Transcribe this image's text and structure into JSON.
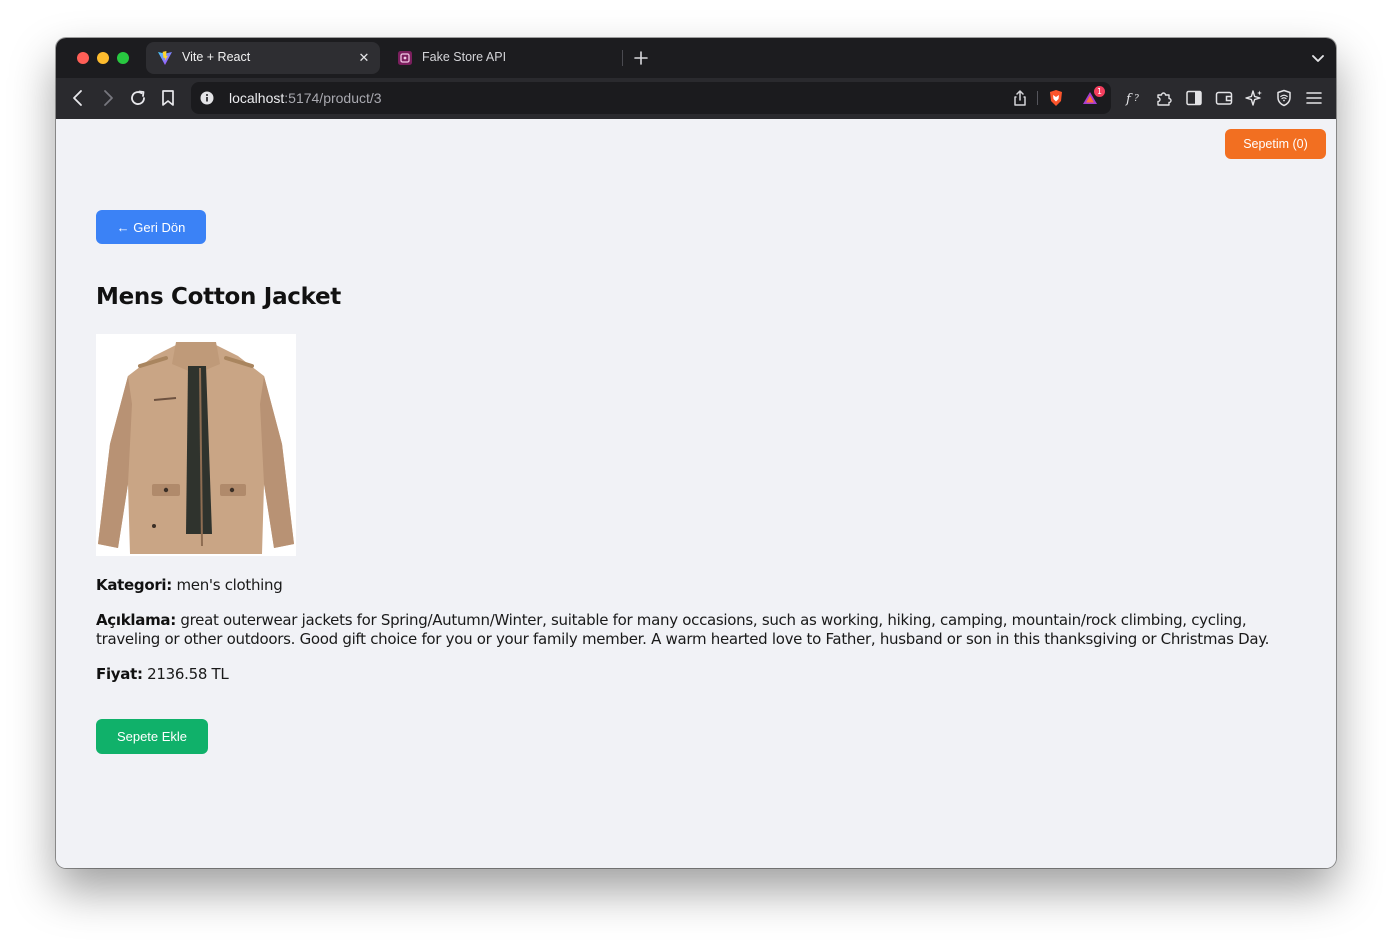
{
  "browser": {
    "tabs": [
      {
        "title": "Vite + React",
        "favicon": "vite-logo-icon",
        "active": true
      },
      {
        "title": "Fake Store API",
        "favicon": "fake-store-favicon-icon",
        "active": false
      }
    ],
    "url": {
      "host": "localhost",
      "path": ":5174/product/3"
    },
    "rewards_badge": "1"
  },
  "page": {
    "cart_button": "Sepetim (0)",
    "back_button": "← Geri Dön",
    "product": {
      "title": "Mens Cotton Jacket",
      "image_alt": "jacket-photo",
      "category_label": "Kategori:",
      "category": "men's clothing",
      "description_label": "Açıklama:",
      "description": "great outerwear jackets for Spring/Autumn/Winter, suitable for many occasions, such as working, hiking, camping, mountain/rock climbing, cycling, traveling or other outdoors. Good gift choice for you or your family member. A warm hearted love to Father, husband or son in this thanksgiving or Christmas Day.",
      "price_label": "Fiyat:",
      "price": "2136.58 TL"
    },
    "add_to_cart_button": "Sepete Ekle"
  },
  "colors": {
    "cart_button": "#f26f21",
    "back_button": "#3b82f6",
    "add_to_cart_button": "#10b16a",
    "page_background": "#f1f2f6"
  }
}
